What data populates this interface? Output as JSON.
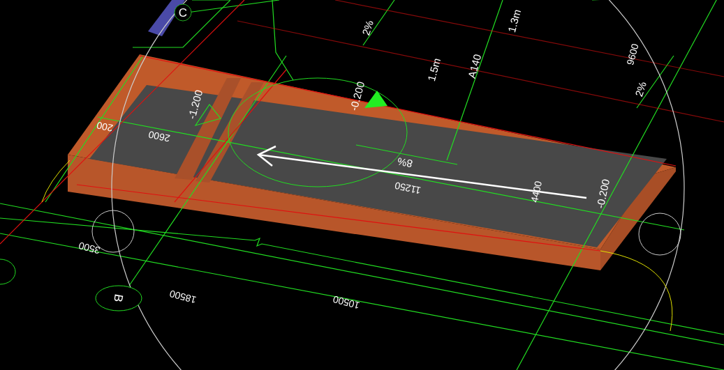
{
  "viewport": {
    "axis_bubbles": [
      {
        "text": "C"
      },
      {
        "text": "B"
      }
    ],
    "labels": [
      {
        "kind": "slope",
        "text": "2%"
      },
      {
        "kind": "note",
        "text": "1.5m"
      },
      {
        "kind": "note",
        "text": "A140"
      },
      {
        "kind": "note",
        "text": "1.3m"
      },
      {
        "kind": "dimension",
        "text": "9600"
      },
      {
        "kind": "slope",
        "text": "2%"
      },
      {
        "kind": "elevation",
        "text": "-0.200"
      },
      {
        "kind": "elevation",
        "text": "-1.200"
      },
      {
        "kind": "dimension",
        "text": "200"
      },
      {
        "kind": "dimension",
        "text": "2600"
      },
      {
        "kind": "slope",
        "text": "8%"
      },
      {
        "kind": "dimension",
        "text": "11250"
      },
      {
        "kind": "dimension",
        "text": "4400"
      },
      {
        "kind": "elevation",
        "text": "-0.200"
      },
      {
        "kind": "dimension",
        "text": "3500"
      },
      {
        "kind": "dimension",
        "text": "18500"
      },
      {
        "kind": "dimension",
        "text": "10500"
      }
    ]
  }
}
